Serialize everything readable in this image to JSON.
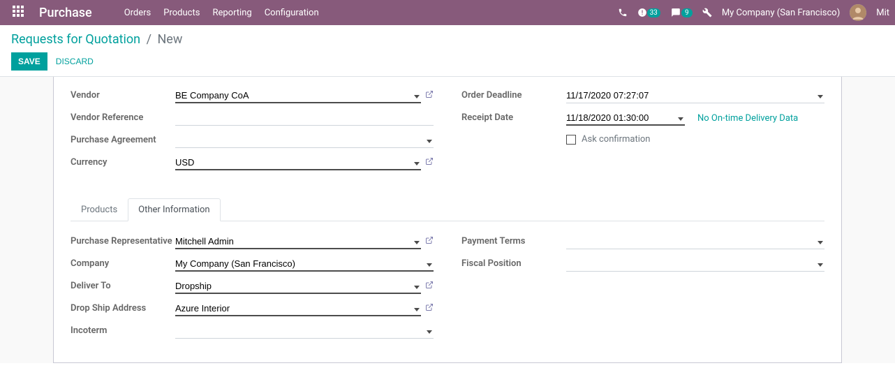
{
  "navbar": {
    "brand": "Purchase",
    "menu": [
      "Orders",
      "Products",
      "Reporting",
      "Configuration"
    ],
    "activities_badge": "33",
    "messages_badge": "9",
    "company": "My Company (San Francisco)",
    "user_short": "Mit"
  },
  "breadcrumb": {
    "root": "Requests for Quotation",
    "current": "New"
  },
  "buttons": {
    "save": "Save",
    "discard": "Discard"
  },
  "form": {
    "left": {
      "vendor_label": "Vendor",
      "vendor_value": "BE Company CoA",
      "vendor_ref_label": "Vendor Reference",
      "vendor_ref_value": "",
      "pa_label": "Purchase Agreement",
      "pa_value": "",
      "currency_label": "Currency",
      "currency_value": "USD"
    },
    "right": {
      "deadline_label": "Order Deadline",
      "deadline_value": "11/17/2020 07:27:07",
      "receipt_label": "Receipt Date",
      "receipt_value": "11/18/2020 01:30:00",
      "receipt_info": "No On-time Delivery Data",
      "ask_confirm_label": "Ask confirmation"
    }
  },
  "tabs": {
    "products": "Products",
    "other": "Other Information"
  },
  "other": {
    "left": {
      "rep_label": "Purchase Representative",
      "rep_value": "Mitchell Admin",
      "company_label": "Company",
      "company_value": "My Company (San Francisco)",
      "deliver_label": "Deliver To",
      "deliver_value": "Dropship",
      "dropship_label": "Drop Ship Address",
      "dropship_value": "Azure Interior",
      "incoterm_label": "Incoterm",
      "incoterm_value": ""
    },
    "right": {
      "payment_label": "Payment Terms",
      "payment_value": "",
      "fiscal_label": "Fiscal Position",
      "fiscal_value": ""
    }
  }
}
